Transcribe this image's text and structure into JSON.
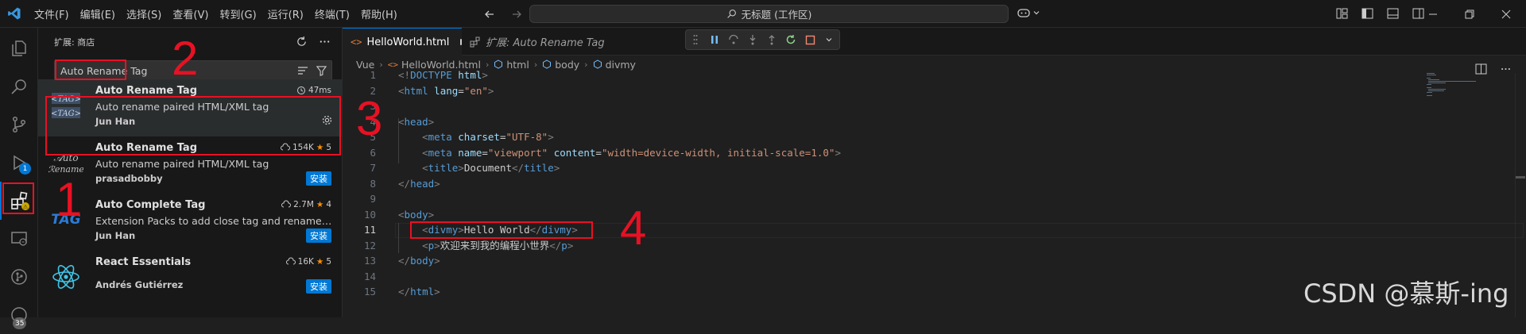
{
  "titlebar": {
    "menu": [
      "文件(F)",
      "编辑(E)",
      "选择(S)",
      "查看(V)",
      "转到(G)",
      "运行(R)",
      "终端(T)",
      "帮助(H)"
    ],
    "command_center": "无标题 (工作区)"
  },
  "activity": {
    "badges": {
      "run": "1",
      "accounts": "35"
    }
  },
  "sidebar": {
    "title": "扩展: 商店",
    "search_value": "Auto Rename Tag",
    "extensions": [
      {
        "name": "Auto Rename Tag",
        "description": "Auto rename paired HTML/XML tag",
        "author": "Jun Han",
        "meta": "47ms",
        "action": ""
      },
      {
        "name": "Auto Rename Tag",
        "description": "Auto rename paired HTML/XML tag",
        "author": "prasadbobby",
        "meta": "154K",
        "rating": "5",
        "action": "安装"
      },
      {
        "name": "Auto Complete Tag",
        "description": "Extension Packs to add close tag and rename paire...",
        "author": "Jun Han",
        "meta": "2.7M",
        "rating": "4",
        "action": "安装",
        "icon_text": "TAG"
      },
      {
        "name": "React Essentials",
        "description": "",
        "author": "Andrés Gutiérrez",
        "meta": "16K",
        "rating": "5",
        "action": "安装"
      }
    ]
  },
  "tabs": [
    {
      "label": "HelloWorld.html"
    },
    {
      "label": "扩展: Auto Rename Tag"
    }
  ],
  "breadcrumb": [
    "Vue",
    "HelloWorld.html",
    "html",
    "body",
    "divmy"
  ],
  "editor": {
    "current_line": 11,
    "lines": [
      {
        "n": "1",
        "code": [
          [
            "t",
            "<!"
          ],
          [
            "tg",
            "DOCTYPE"
          ],
          [
            "tx",
            " "
          ],
          [
            "at",
            "html"
          ],
          [
            "t",
            ">"
          ]
        ]
      },
      {
        "n": "2",
        "code": [
          [
            "t",
            "<"
          ],
          [
            "tg",
            "html"
          ],
          [
            "tx",
            " "
          ],
          [
            "at",
            "lang"
          ],
          [
            "tx",
            "="
          ],
          [
            "st",
            "\"en\""
          ],
          [
            "t",
            ">"
          ]
        ]
      },
      {
        "n": "3",
        "code": []
      },
      {
        "n": "4",
        "code": [
          [
            "t",
            "<"
          ],
          [
            "tg",
            "head"
          ],
          [
            "t",
            ">"
          ]
        ]
      },
      {
        "n": "5",
        "code": [
          [
            "tx",
            "    "
          ],
          [
            "t",
            "<"
          ],
          [
            "tg",
            "meta"
          ],
          [
            "tx",
            " "
          ],
          [
            "at",
            "charset"
          ],
          [
            "tx",
            "="
          ],
          [
            "st",
            "\"UTF-8\""
          ],
          [
            "t",
            ">"
          ]
        ]
      },
      {
        "n": "6",
        "code": [
          [
            "tx",
            "    "
          ],
          [
            "t",
            "<"
          ],
          [
            "tg",
            "meta"
          ],
          [
            "tx",
            " "
          ],
          [
            "at",
            "name"
          ],
          [
            "tx",
            "="
          ],
          [
            "st",
            "\"viewport\""
          ],
          [
            "tx",
            " "
          ],
          [
            "at",
            "content"
          ],
          [
            "tx",
            "="
          ],
          [
            "st",
            "\"width=device-width, initial-scale=1.0\""
          ],
          [
            "t",
            ">"
          ]
        ]
      },
      {
        "n": "7",
        "code": [
          [
            "tx",
            "    "
          ],
          [
            "t",
            "<"
          ],
          [
            "tg",
            "title"
          ],
          [
            "t",
            ">"
          ],
          [
            "tx",
            "Document"
          ],
          [
            "t",
            "</"
          ],
          [
            "tg",
            "title"
          ],
          [
            "t",
            ">"
          ]
        ]
      },
      {
        "n": "8",
        "code": [
          [
            "t",
            "</"
          ],
          [
            "tg",
            "head"
          ],
          [
            "t",
            ">"
          ]
        ]
      },
      {
        "n": "9",
        "code": []
      },
      {
        "n": "10",
        "code": [
          [
            "t",
            "<"
          ],
          [
            "tg",
            "body"
          ],
          [
            "t",
            ">"
          ]
        ]
      },
      {
        "n": "11",
        "code": [
          [
            "tx",
            "    "
          ],
          [
            "t",
            "<"
          ],
          [
            "tg",
            "divmy"
          ],
          [
            "t",
            ">"
          ],
          [
            "tx",
            "Hello World"
          ],
          [
            "t",
            "</"
          ],
          [
            "tg",
            "divmy"
          ],
          [
            "t",
            ">"
          ]
        ]
      },
      {
        "n": "12",
        "code": [
          [
            "tx",
            "    "
          ],
          [
            "t",
            "<"
          ],
          [
            "tg",
            "p"
          ],
          [
            "t",
            ">"
          ],
          [
            "tx",
            "欢迎来到我的编程小世界"
          ],
          [
            "t",
            "</"
          ],
          [
            "tg",
            "p"
          ],
          [
            "t",
            ">"
          ]
        ]
      },
      {
        "n": "13",
        "code": [
          [
            "t",
            "</"
          ],
          [
            "tg",
            "body"
          ],
          [
            "t",
            ">"
          ]
        ]
      },
      {
        "n": "14",
        "code": []
      },
      {
        "n": "15",
        "code": [
          [
            "t",
            "</"
          ],
          [
            "tg",
            "html"
          ],
          [
            "t",
            ">"
          ]
        ]
      }
    ]
  },
  "annotations": [
    "1",
    "2",
    "3",
    "4"
  ],
  "watermark": "CSDN @慕斯-ing",
  "colors": {
    "accent": "#0078d4",
    "annotation": "#e81123",
    "star": "#ff8e00"
  }
}
